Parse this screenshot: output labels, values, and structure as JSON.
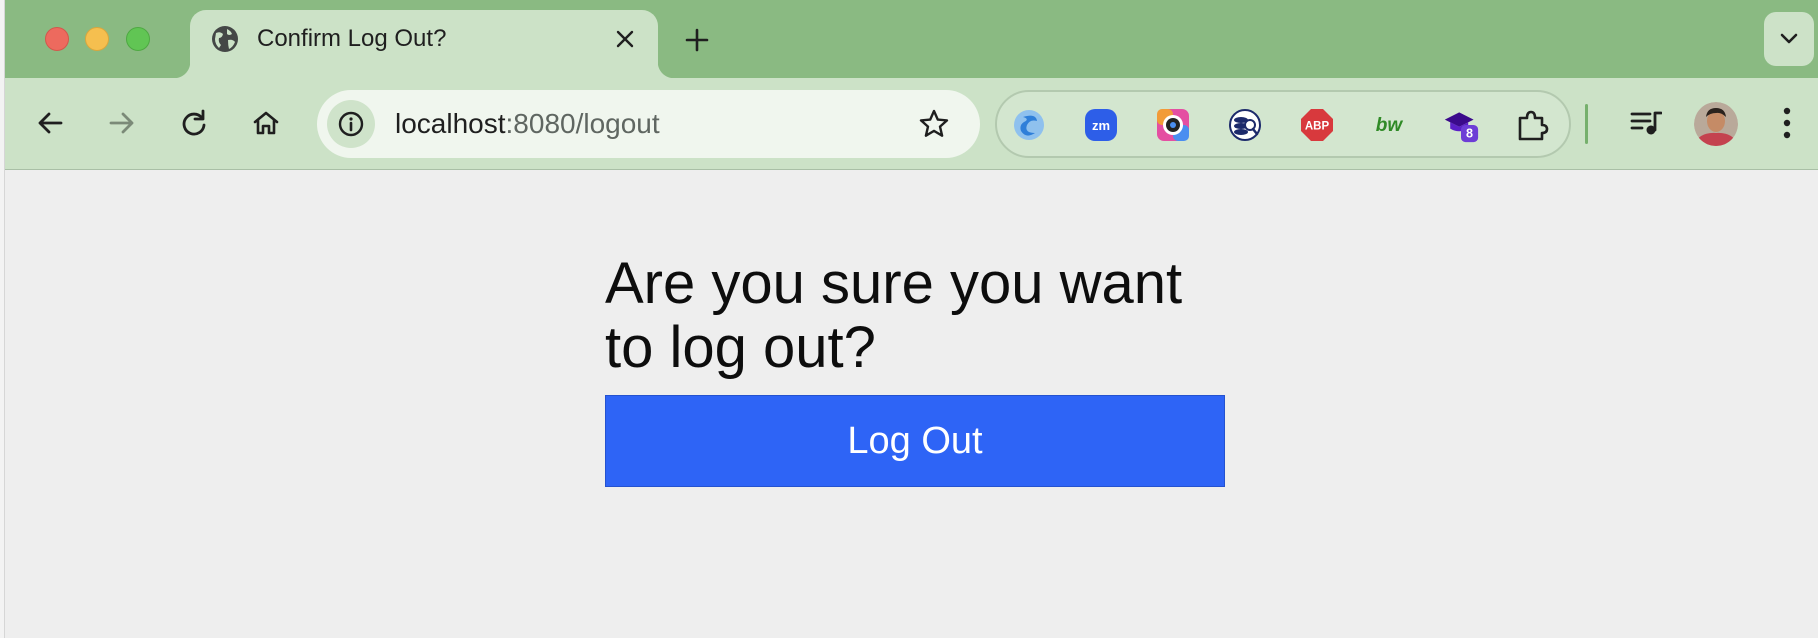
{
  "tab": {
    "title": "Confirm Log Out?",
    "icon": "globe-icon"
  },
  "address_bar": {
    "host": "localhost",
    "path": ":8080/logout"
  },
  "extensions": {
    "abp_label": "ABP",
    "bw_label": "bw",
    "zm_label": "zm",
    "badge_count": "8"
  },
  "page": {
    "heading": "Are you sure you want to log out?",
    "button_label": "Log Out"
  },
  "colors": {
    "tab_strip": "#8aba82",
    "toolbar": "#cce2c7",
    "page_background": "#eeeeee",
    "button": "#2e64f6",
    "button_text": "#ffffff"
  }
}
